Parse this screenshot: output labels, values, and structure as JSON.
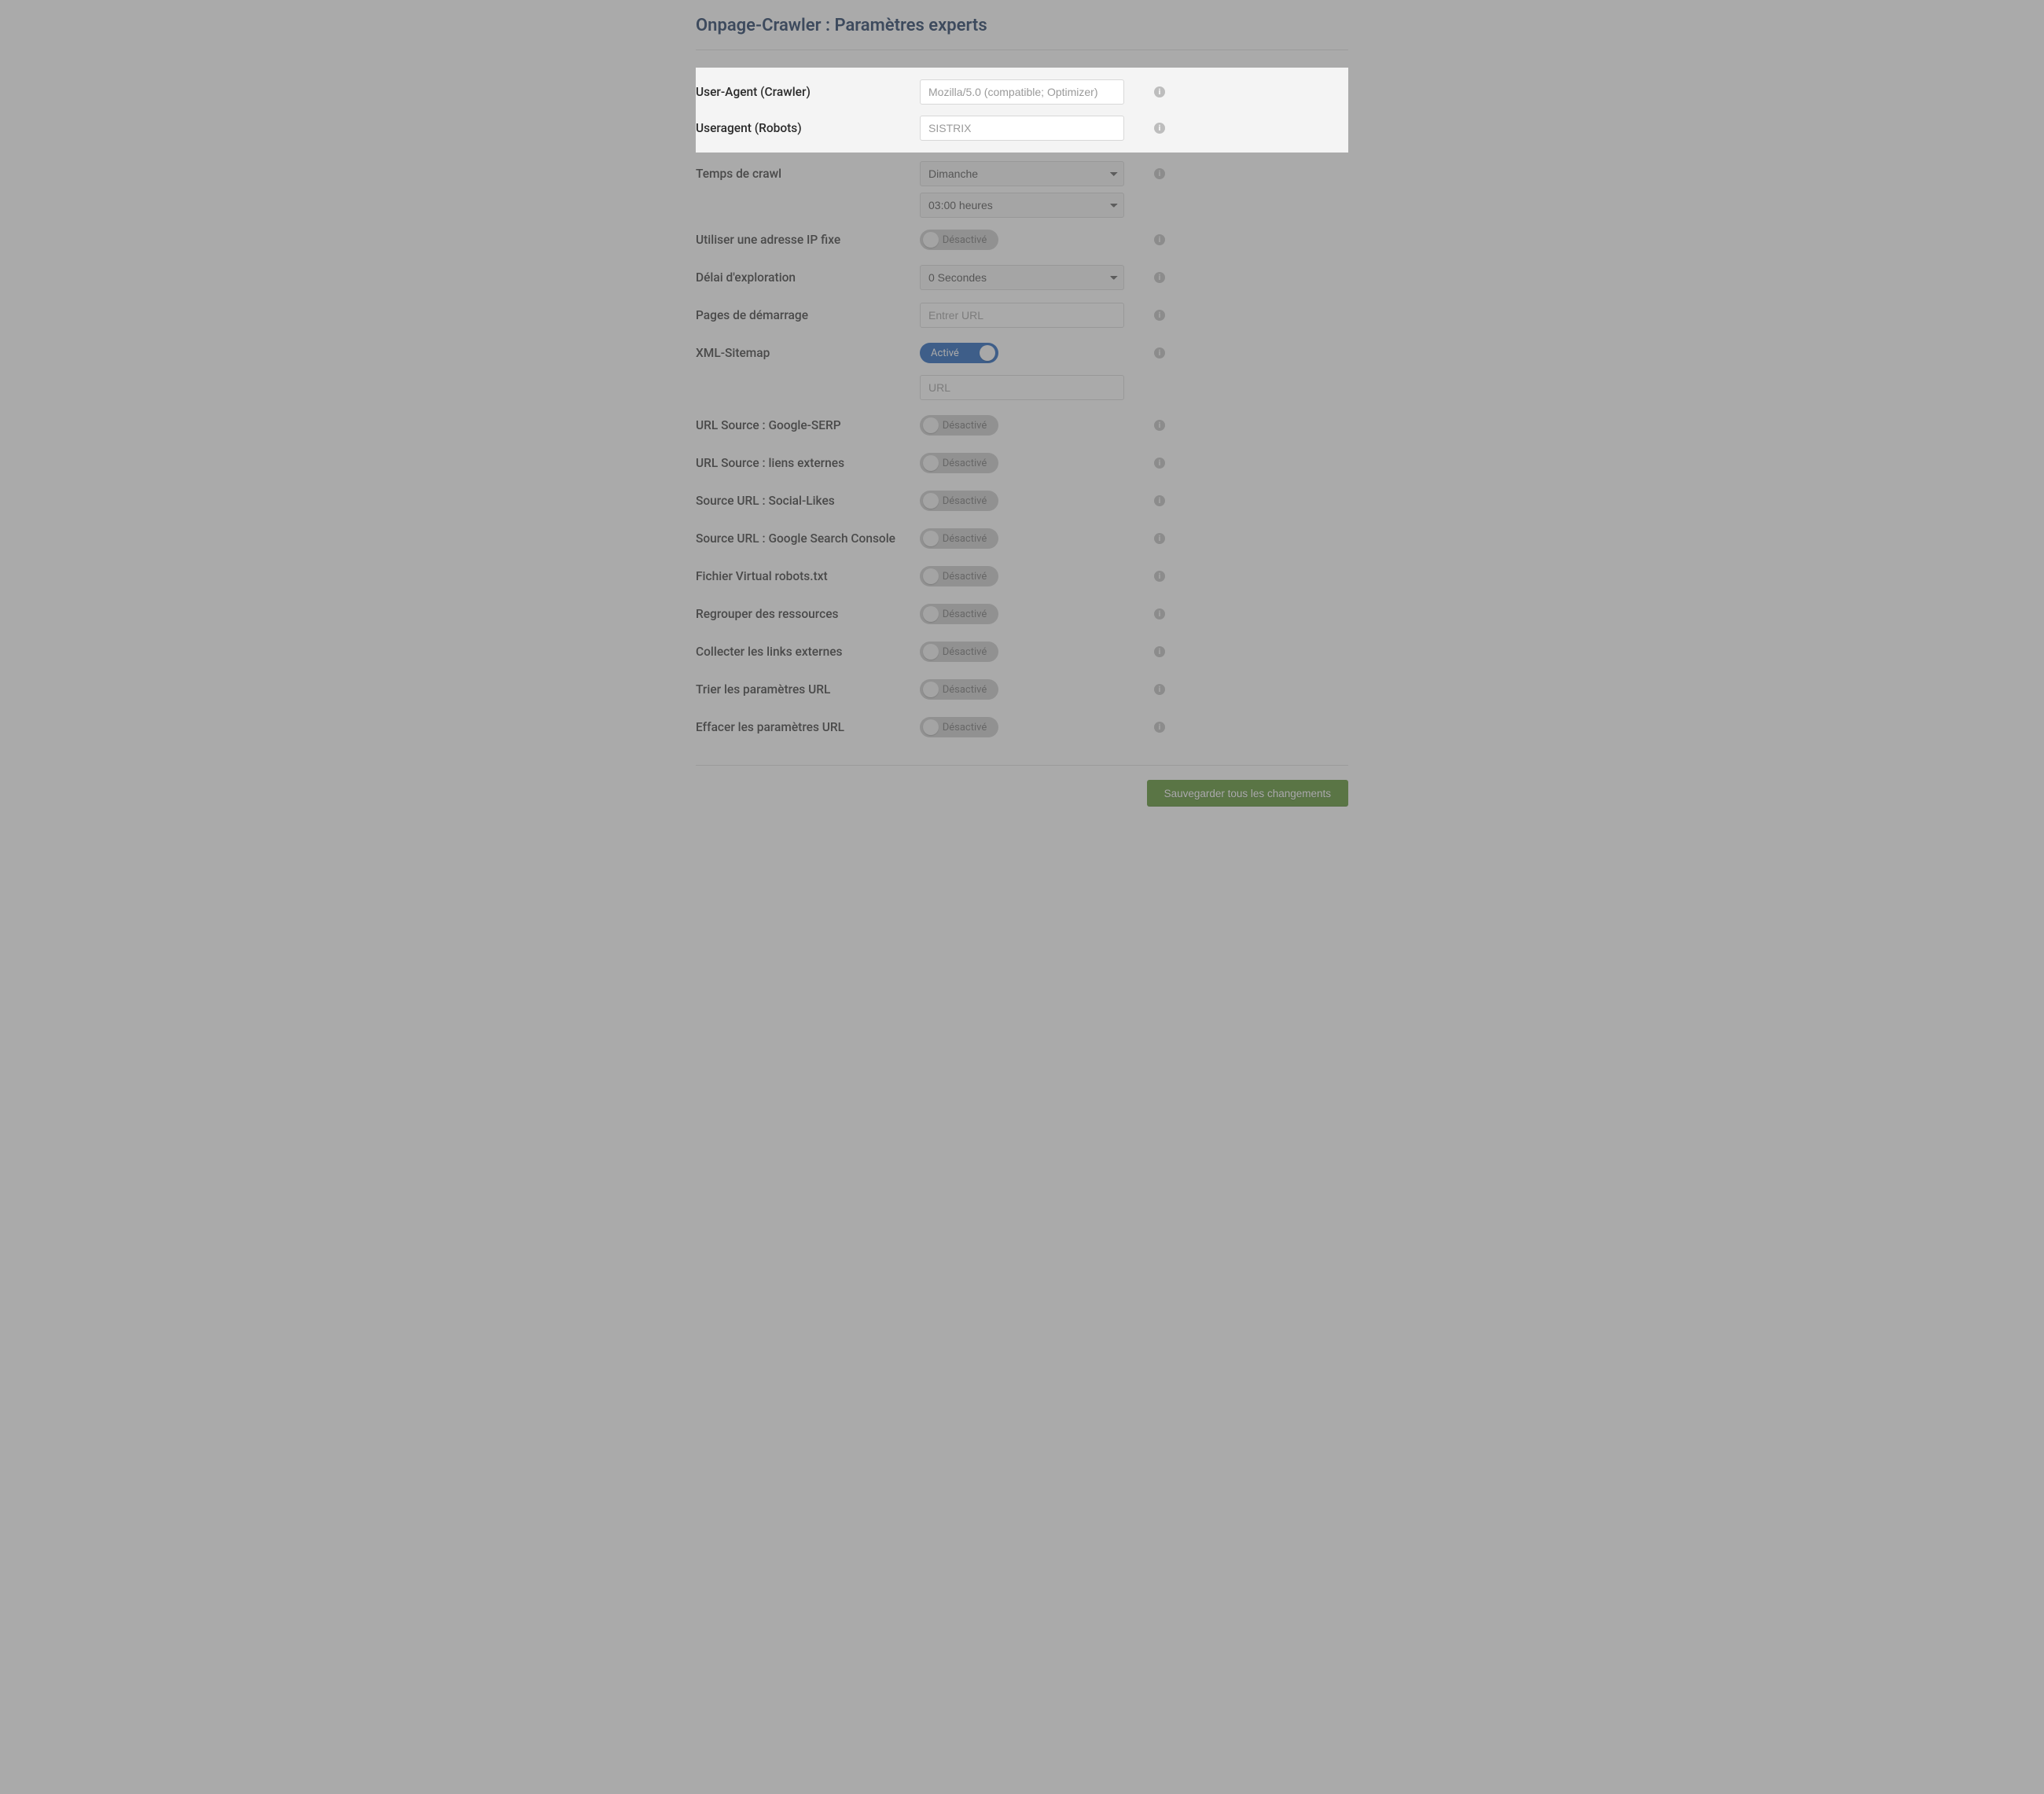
{
  "page": {
    "title": "Onpage-Crawler : Paramètres experts"
  },
  "toggle_labels": {
    "on": "Activé",
    "off": "Désactivé"
  },
  "fields": {
    "user_agent_crawler": {
      "label": "User-Agent (Crawler)",
      "placeholder": "Mozilla/5.0 (compatible; Optimizer)"
    },
    "user_agent_robots": {
      "label": "Useragent (Robots)",
      "placeholder": "SISTRIX"
    },
    "crawl_time": {
      "label": "Temps de crawl",
      "day_value": "Dimanche",
      "hour_value": "03:00 heures"
    },
    "fixed_ip": {
      "label": "Utiliser une adresse IP fixe",
      "state": "off"
    },
    "crawl_delay": {
      "label": "Délai d'exploration",
      "value": "0 Secondes"
    },
    "start_pages": {
      "label": "Pages de démarrage",
      "placeholder": "Entrer URL"
    },
    "xml_sitemap": {
      "label": "XML-Sitemap",
      "state": "on",
      "url_placeholder": "URL"
    },
    "src_google_serp": {
      "label": "URL Source : Google-SERP",
      "state": "off"
    },
    "src_ext_links": {
      "label": "URL Source : liens externes",
      "state": "off"
    },
    "src_social": {
      "label": "Source URL : Social-Likes",
      "state": "off"
    },
    "src_gsc": {
      "label": "Source URL : Google Search Console",
      "state": "off"
    },
    "virtual_robots": {
      "label": "Fichier Virtual robots.txt",
      "state": "off"
    },
    "group_resources": {
      "label": "Regrouper des ressources",
      "state": "off"
    },
    "collect_ext_links": {
      "label": "Collecter les links externes",
      "state": "off"
    },
    "sort_url_params": {
      "label": "Trier les paramètres URL",
      "state": "off"
    },
    "strip_url_params": {
      "label": "Effacer les paramètres URL",
      "state": "off"
    }
  },
  "actions": {
    "save": "Sauvegarder tous les changements"
  }
}
